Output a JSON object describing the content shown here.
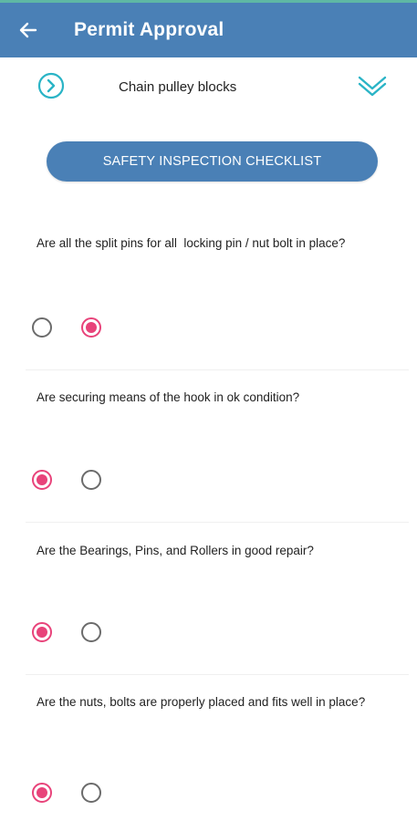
{
  "appbar": {
    "title": "Permit Approval",
    "back_icon": "arrow-left-icon",
    "background": "#4a80b6"
  },
  "equipment": {
    "name": "Chain pulley blocks",
    "nav_icon": "chevron-right-circle-icon",
    "expand_icon": "double-chevron-down-icon"
  },
  "checklist_button": {
    "label": "SAFETY INSPECTION CHECKLIST"
  },
  "questions": [
    {
      "text": "Are all the split pins for all  locking pin / nut bolt in place?",
      "selected_option": 2
    },
    {
      "text": "Are securing means of the hook in ok condition?",
      "selected_option": 1
    },
    {
      "text": "Are the Bearings, Pins, and Rollers in good repair?",
      "selected_option": 1
    },
    {
      "text": "Are the nuts, bolts are properly placed and fits well in place?",
      "selected_option": 1
    }
  ],
  "colors": {
    "accent_teal": "#2ab4c6",
    "radio_selected": "#e8437a",
    "radio_unselected": "#6b6b6b"
  }
}
